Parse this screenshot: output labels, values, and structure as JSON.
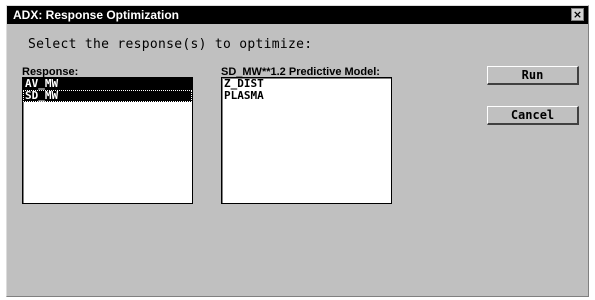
{
  "window": {
    "title": "ADX: Response Optimization",
    "close_glyph": "×",
    "close_icon": "close-icon"
  },
  "instruction": "Select the response(s) to optimize:",
  "response_list": {
    "label": "Response:",
    "items": [
      {
        "text": "AV_MW",
        "selected": true
      },
      {
        "text": "SD_MW",
        "selected": true
      }
    ]
  },
  "model_list": {
    "label": "SD_MW**1.2 Predictive Model:",
    "items": [
      {
        "text": "Z_DIST",
        "selected": false
      },
      {
        "text": "PLASMA",
        "selected": false
      }
    ]
  },
  "buttons": {
    "run_label": "Run",
    "cancel_label": "Cancel"
  },
  "colors": {
    "dialog_bg": "#c0c0c0",
    "titlebar_bg": "#000000",
    "selection_bg": "#000000",
    "list_bg": "#ffffff"
  }
}
